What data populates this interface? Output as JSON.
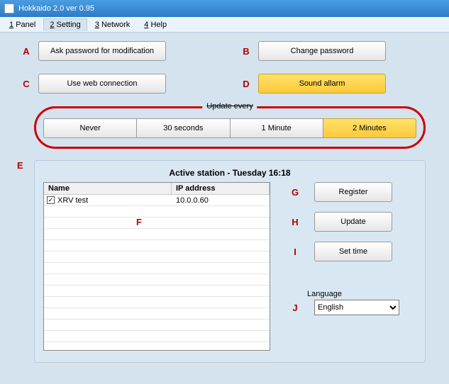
{
  "window": {
    "title": "Hokkaido 2.0 ver 0.95"
  },
  "menu": {
    "panel": {
      "accel": "1",
      "label": "Panel"
    },
    "setting": {
      "accel": "2",
      "label": "Setting"
    },
    "network": {
      "accel": "3",
      "label": "Network"
    },
    "help": {
      "accel": "4",
      "label": "Help"
    }
  },
  "markers": {
    "A": "A",
    "B": "B",
    "C": "C",
    "D": "D",
    "E": "E",
    "F": "F",
    "G": "G",
    "H": "H",
    "I": "I",
    "J": "J"
  },
  "buttons": {
    "askPassword": "Ask password for modification",
    "changePassword": "Change password",
    "useWeb": "Use web connection",
    "soundAlarm": "Sound allarm",
    "register": "Register",
    "update": "Update",
    "setTime": "Set time"
  },
  "updateGroup": {
    "label": "Update every",
    "options": [
      "Never",
      "30 seconds",
      "1 Minute",
      "2 Minutes"
    ],
    "selected": 3
  },
  "stationPanel": {
    "title": "Active station - Tuesday 16:18",
    "columns": {
      "name": "Name",
      "ip": "IP address"
    },
    "rows": [
      {
        "checked": true,
        "name": "XRV test",
        "ip": "10.0.0.60"
      }
    ],
    "blankRows": 14
  },
  "language": {
    "label": "Language",
    "selected": "English"
  }
}
